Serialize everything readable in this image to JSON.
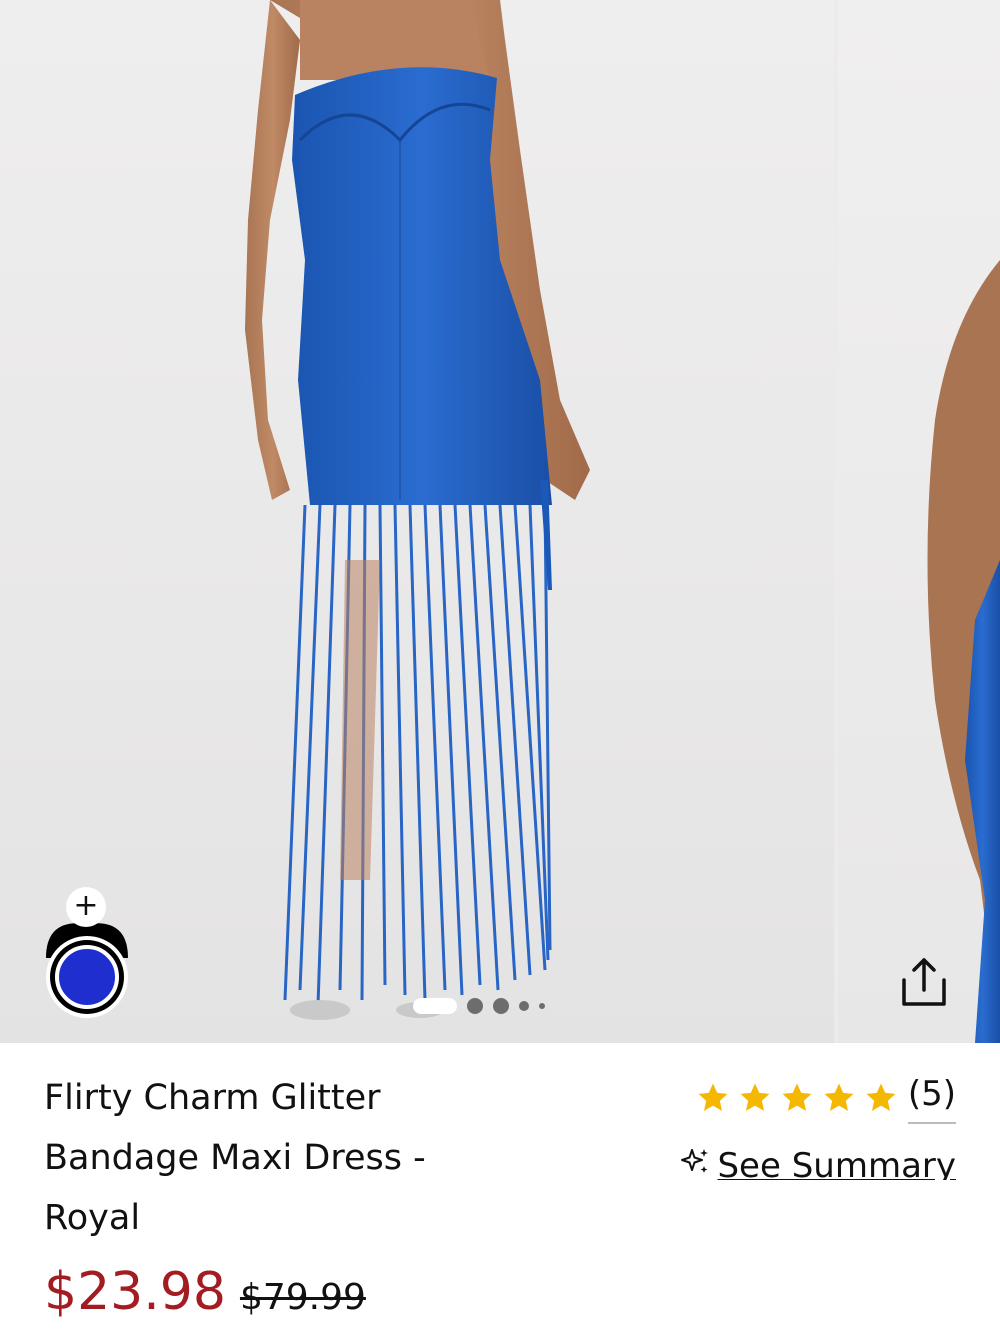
{
  "gallery": {
    "image_alt": "Model wearing blue strapless fringe maxi dress",
    "slide_count": 6,
    "active_slide": 1,
    "share_icon": "share-icon",
    "add_swatch_label": "+",
    "swatch_color": "#1f2fcf"
  },
  "product": {
    "title": "Flirty Charm Glitter Bandage Maxi Dress - Royal",
    "sale_price": "$23.98",
    "original_price": "$79.99",
    "sale_color": "#a21c22"
  },
  "rating": {
    "stars": 5,
    "star_color": "#f5b800",
    "review_count": "(5)"
  },
  "summary": {
    "icon": "sparkle-icon",
    "label": "See Summary"
  }
}
